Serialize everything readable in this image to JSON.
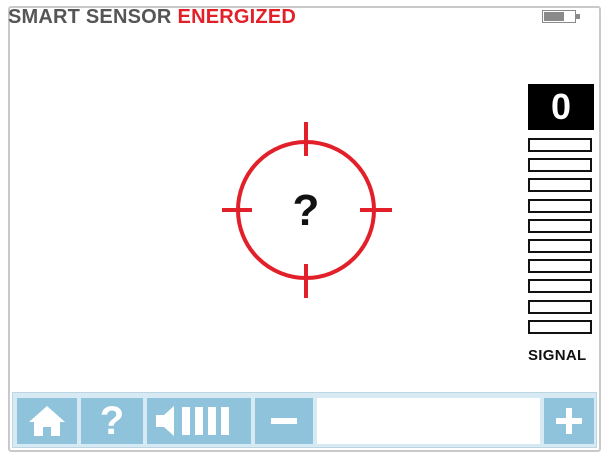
{
  "header": {
    "title_prefix": "SMART SENSOR",
    "title_status": "ENERGIZED",
    "status_color": "#e2202a",
    "battery_icon": "battery-icon",
    "battery_level": 0.65
  },
  "target": {
    "symbol": "?",
    "reticle_color": "#e2202a",
    "icon": "crosshair-icon"
  },
  "signal": {
    "value": "0",
    "label": "SIGNAL",
    "bars_total": 10,
    "bars_filled": 0
  },
  "toolbar": {
    "home_icon": "home-icon",
    "help_label": "?",
    "volume_icon": "speaker-volume-icon",
    "volume_level": 1.0,
    "minus_icon": "minus-icon",
    "plus_icon": "plus-icon",
    "slider_level": 0,
    "accent": "#8fc3dc",
    "background": "#d7e9f2"
  }
}
